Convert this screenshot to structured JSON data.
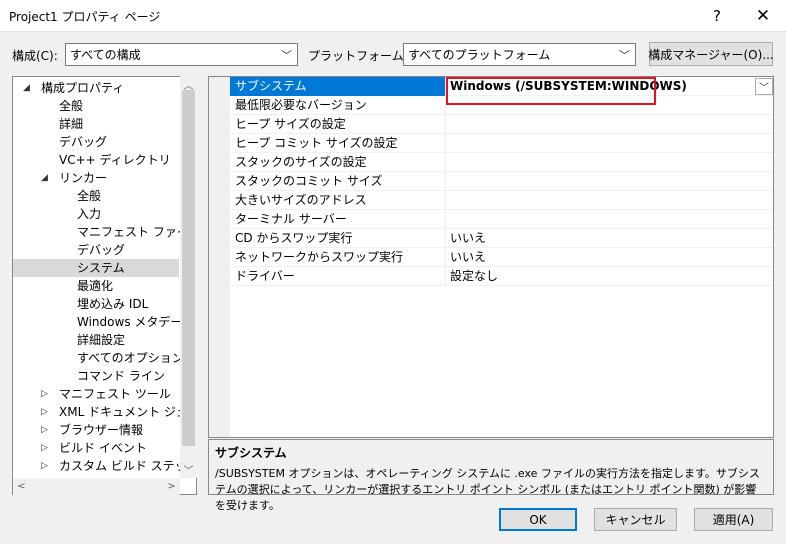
{
  "window": {
    "title": "Project1 プロパティ ページ",
    "help_label": "?",
    "close_label": "✕"
  },
  "toolbar": {
    "config_label": "構成(C):",
    "config_value": "すべての構成",
    "platform_label": "プラットフォーム(P):",
    "platform_value": "すべてのプラットフォーム",
    "config_manager_label": "構成マネージャー(O)..."
  },
  "tree": {
    "items": [
      {
        "label": "構成プロパティ",
        "level": 0,
        "arrow": "◢"
      },
      {
        "label": "全般",
        "level": 1
      },
      {
        "label": "詳細",
        "level": 1
      },
      {
        "label": "デバッグ",
        "level": 1
      },
      {
        "label": "VC++ ディレクトリ",
        "level": 1
      },
      {
        "label": "リンカー",
        "level": 1,
        "arrow": "◢"
      },
      {
        "label": "全般",
        "level": 2
      },
      {
        "label": "入力",
        "level": 2
      },
      {
        "label": "マニフェスト ファイル",
        "level": 2
      },
      {
        "label": "デバッグ",
        "level": 2
      },
      {
        "label": "システム",
        "level": 2,
        "selected": true
      },
      {
        "label": "最適化",
        "level": 2
      },
      {
        "label": "埋め込み IDL",
        "level": 2
      },
      {
        "label": "Windows メタデータ",
        "level": 2
      },
      {
        "label": "詳細設定",
        "level": 2
      },
      {
        "label": "すべてのオプション",
        "level": 2
      },
      {
        "label": "コマンド ライン",
        "level": 2
      },
      {
        "label": "マニフェスト ツール",
        "level": 1,
        "arrow": "▷"
      },
      {
        "label": "XML ドキュメント ジェネレー",
        "level": 1,
        "arrow": "▷"
      },
      {
        "label": "ブラウザー情報",
        "level": 1,
        "arrow": "▷"
      },
      {
        "label": "ビルド イベント",
        "level": 1,
        "arrow": "▷"
      },
      {
        "label": "カスタム ビルド ステップ",
        "level": 1,
        "arrow": "▷"
      }
    ]
  },
  "grid": {
    "rows": [
      {
        "name": "サブシステム",
        "value": "Windows (/SUBSYSTEM:WINDOWS)",
        "selected": true
      },
      {
        "name": "最低限必要なバージョン",
        "value": ""
      },
      {
        "name": "ヒープ サイズの設定",
        "value": ""
      },
      {
        "name": "ヒープ コミット サイズの設定",
        "value": ""
      },
      {
        "name": "スタックのサイズの設定",
        "value": ""
      },
      {
        "name": "スタックのコミット サイズ",
        "value": ""
      },
      {
        "name": "大きいサイズのアドレス",
        "value": ""
      },
      {
        "name": "ターミナル サーバー",
        "value": ""
      },
      {
        "name": "CD からスワップ実行",
        "value": "いいえ"
      },
      {
        "name": "ネットワークからスワップ実行",
        "value": "いいえ"
      },
      {
        "name": "ドライバー",
        "value": "設定なし"
      }
    ]
  },
  "description": {
    "title": "サブシステム",
    "body": "/SUBSYSTEM オプションは、オペレーティング システムに .exe ファイルの実行方法を指定します。サブシステムの選択によって、リンカーが選択するエントリ ポイント シンボル (またはエントリ ポイント関数) が影響を受けます。"
  },
  "footer": {
    "ok_label": "OK",
    "cancel_label": "キャンセル",
    "apply_label": "適用(A)"
  },
  "colors": {
    "accent": "#0078d7",
    "highlight_border": "#e81123"
  }
}
